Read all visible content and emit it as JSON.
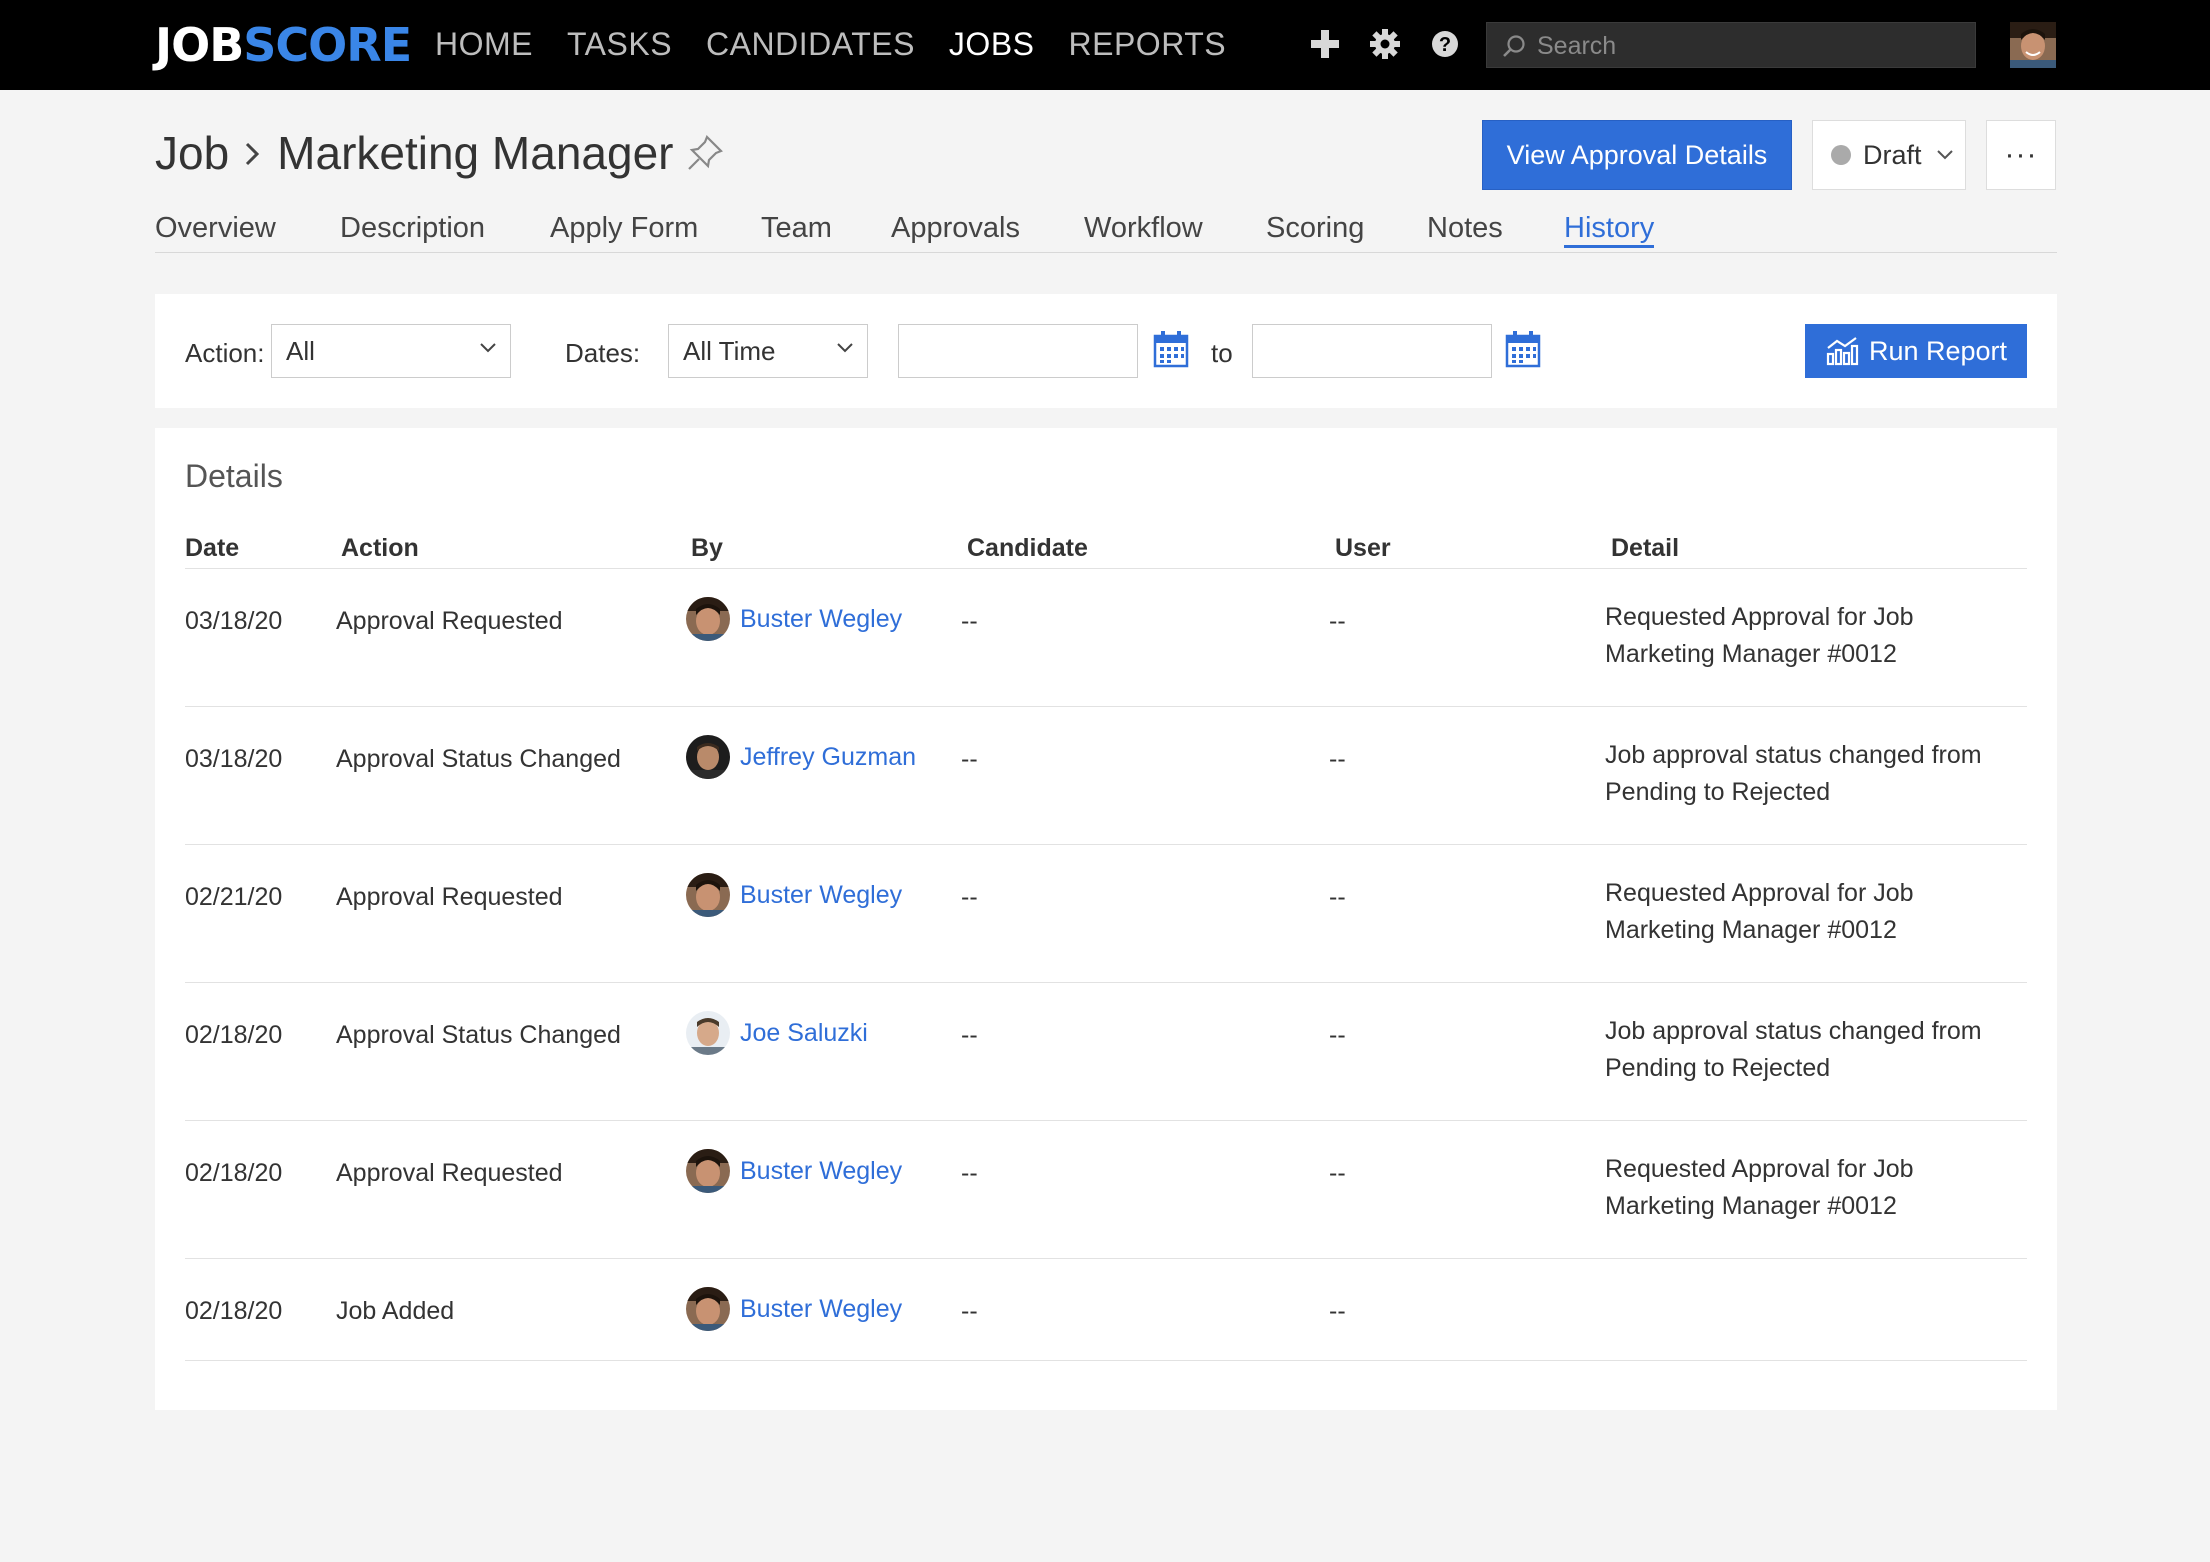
{
  "app": {
    "logo_a": "JOB",
    "logo_b": "SCORE",
    "nav": [
      "HOME",
      "TASKS",
      "CANDIDATES",
      "JOBS",
      "REPORTS"
    ],
    "active_nav": "JOBS",
    "search_placeholder": "Search"
  },
  "header": {
    "breadcrumb_root": "Job",
    "breadcrumb_sep": "›",
    "title": "Marketing Manager",
    "approval_button": "View Approval Details",
    "status": "Draft",
    "more": "···"
  },
  "tabs": [
    "Overview",
    "Description",
    "Apply Form",
    "Team",
    "Approvals",
    "Workflow",
    "Scoring",
    "Notes",
    "History"
  ],
  "active_tab": "History",
  "filters": {
    "action_label": "Action:",
    "action_value": "All",
    "dates_label": "Dates:",
    "dates_value": "All Time",
    "to_label": "to",
    "run_report": "Run Report"
  },
  "details": {
    "title": "Details",
    "columns": [
      "Date",
      "Action",
      "By",
      "Candidate",
      "User",
      "Detail"
    ],
    "rows": [
      {
        "date": "03/18/20",
        "action": "Approval Requested",
        "by": "Buster Wegley",
        "candidate": "--",
        "user": "--",
        "detail1": "Requested Approval for Job",
        "detail2": "Marketing Manager #0012"
      },
      {
        "date": "03/18/20",
        "action": "Approval Status Changed",
        "by": "Jeffrey Guzman",
        "candidate": "--",
        "user": "--",
        "detail1": "Job approval status changed from",
        "detail2": "Pending to Rejected"
      },
      {
        "date": "02/21/20",
        "action": "Approval Requested",
        "by": "Buster Wegley",
        "candidate": "--",
        "user": "--",
        "detail1": "Requested Approval for Job",
        "detail2": "Marketing Manager #0012"
      },
      {
        "date": "02/18/20",
        "action": "Approval Status Changed",
        "by": "Joe Saluzki",
        "candidate": "--",
        "user": "--",
        "detail1": "Job approval status changed from",
        "detail2": "Pending to Rejected"
      },
      {
        "date": "02/18/20",
        "action": "Approval Requested",
        "by": "Buster Wegley",
        "candidate": "--",
        "user": "--",
        "detail1": "Requested Approval for Job",
        "detail2": "Marketing Manager #0012"
      },
      {
        "date": "02/18/20",
        "action": "Job Added",
        "by": "Buster Wegley",
        "candidate": "--",
        "user": "--",
        "detail1": "",
        "detail2": ""
      }
    ]
  },
  "colors": {
    "brand_blue": "#2f6ed8",
    "nav_bg": "#000000",
    "page_bg": "#f4f4f4"
  }
}
